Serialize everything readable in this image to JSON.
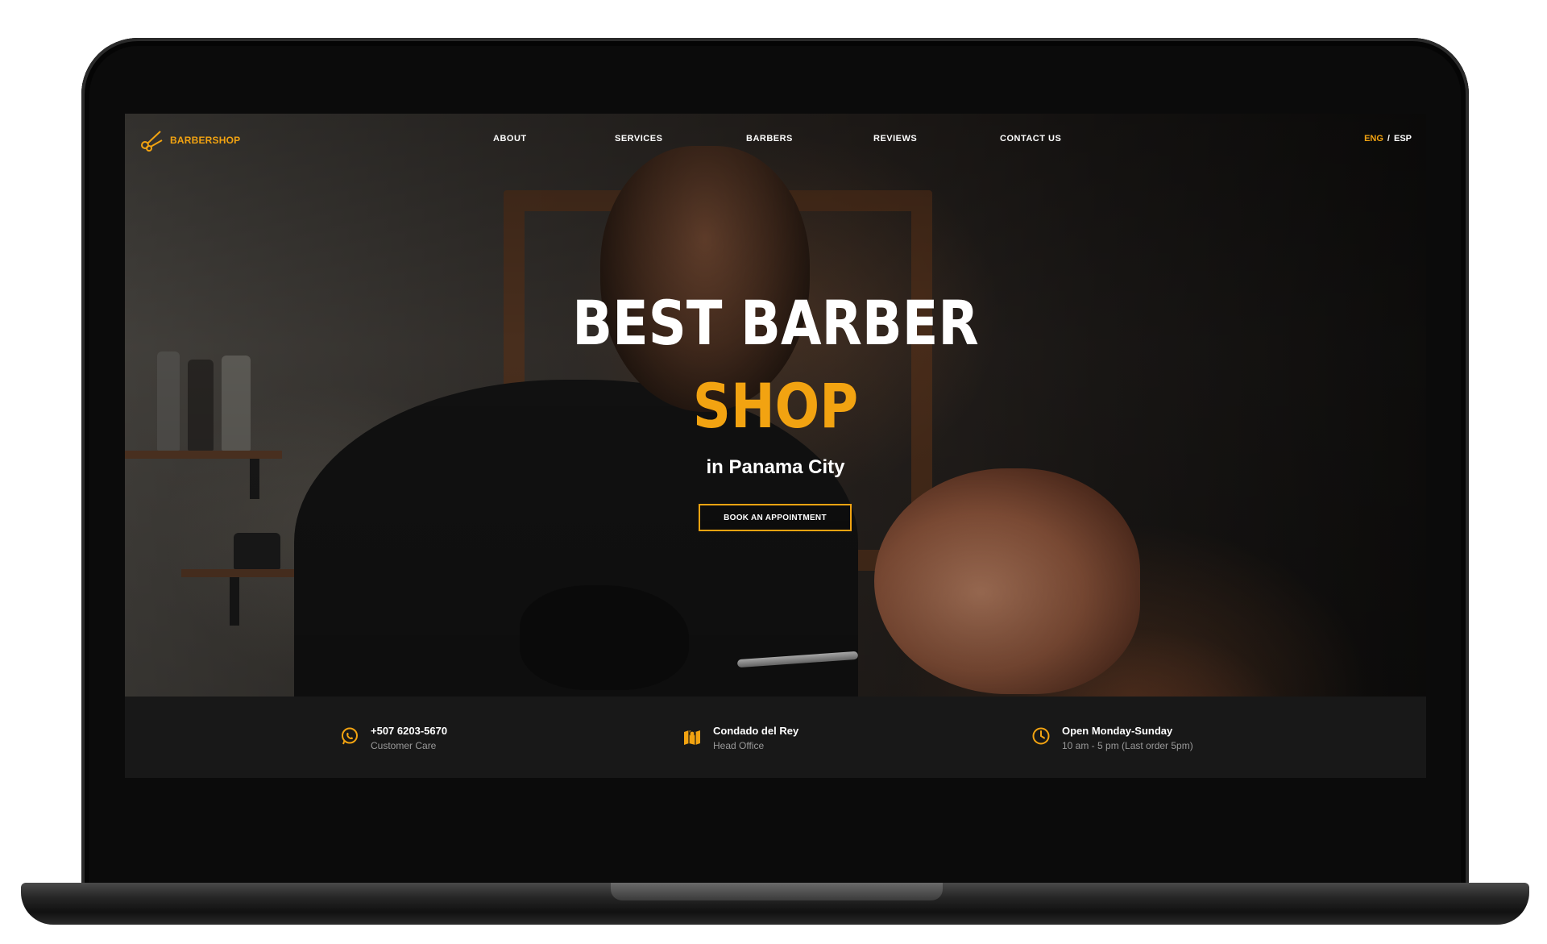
{
  "brand": {
    "name": "BARBERSHOP",
    "accent_color": "#f2a311",
    "logo_icon": "scissors-icon"
  },
  "nav": {
    "links": [
      "ABOUT",
      "SERVICES",
      "BARBERS",
      "REVIEWS",
      "CONTACT US"
    ],
    "lang_active": "ENG",
    "lang_separator": "/",
    "lang_other": "ESP"
  },
  "hero": {
    "title_line1": "BEST BARBER",
    "title_line2": "SHOP",
    "subtitle": "in Panama City",
    "cta_label": "BOOK AN APPOINTMENT"
  },
  "info": [
    {
      "icon": "whatsapp-icon",
      "title": "+507 6203-5670",
      "subtitle": "Customer Care"
    },
    {
      "icon": "map-icon",
      "title": "Condado del Rey",
      "subtitle": "Head Office"
    },
    {
      "icon": "clock-icon",
      "title": "Open Monday-Sunday",
      "subtitle": "10 am - 5 pm (Last order 5pm)"
    }
  ]
}
